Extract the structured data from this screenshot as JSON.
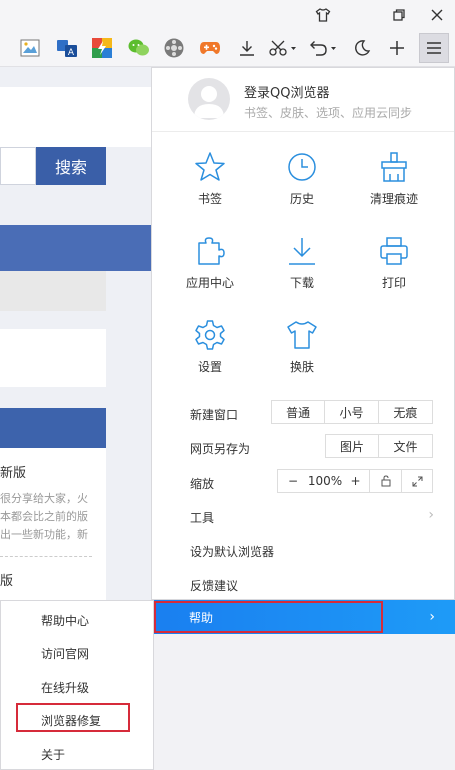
{
  "colors": {
    "accent": "#1e88f2",
    "highlight": "#d62b3a",
    "search_button": "#3a5fa8"
  },
  "title_bar": {
    "icons": [
      "shirt-icon",
      "restore-icon",
      "close-icon"
    ]
  },
  "toolbar": {
    "icons": [
      "image-icon",
      "translate-icon",
      "lightning-icon",
      "wechat-icon",
      "film-icon",
      "game-icon",
      "download-icon",
      "scissors-icon",
      "undo-icon",
      "moon-icon",
      "plus-icon",
      "menu-icon"
    ]
  },
  "background_page": {
    "search_button": "搜索",
    "article_title": "新版",
    "article_lines": [
      "很分享给大家，火",
      "本都会比之前的版",
      "出一些新功能，新"
    ],
    "article_tail": "版"
  },
  "menu": {
    "login_title": "登录QQ浏览器",
    "login_subtitle": "书签、皮肤、选项、应用云同步",
    "grid": [
      {
        "label": "书签",
        "icon": "star-icon"
      },
      {
        "label": "历史",
        "icon": "clock-icon"
      },
      {
        "label": "清理痕迹",
        "icon": "broom-icon"
      },
      {
        "label": "应用中心",
        "icon": "puzzle-icon"
      },
      {
        "label": "下载",
        "icon": "download-icon"
      },
      {
        "label": "打印",
        "icon": "printer-icon"
      },
      {
        "label": "设置",
        "icon": "gear-icon"
      },
      {
        "label": "换肤",
        "icon": "shirt-icon"
      }
    ],
    "new_window": {
      "label": "新建窗口",
      "options": [
        "普通",
        "小号",
        "无痕"
      ]
    },
    "save_page": {
      "label": "网页另存为",
      "options": [
        "图片",
        "文件"
      ]
    },
    "zoom": {
      "label": "缩放",
      "minus": "−",
      "value": "100%",
      "plus": "+"
    },
    "tools": "工具",
    "set_default": "设为默认浏览器",
    "feedback": "反馈建议",
    "help": "帮助",
    "arrow": "›"
  },
  "help_submenu": [
    "帮助中心",
    "访问官网",
    "在线升级",
    "浏览器修复",
    "关于"
  ]
}
